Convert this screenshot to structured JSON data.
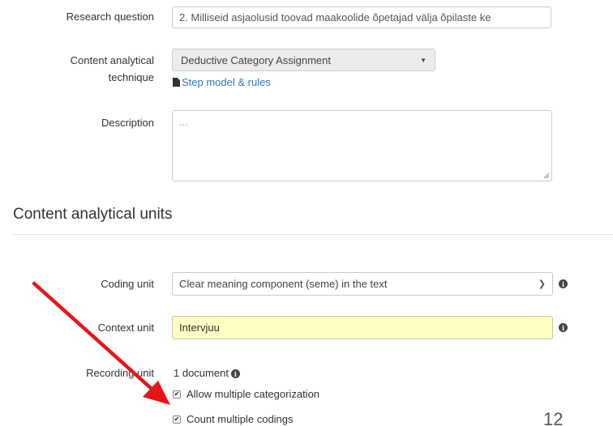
{
  "form": {
    "research_question": {
      "label": "Research question",
      "value": "2. Milliseid asjaolusid toovad maakoolide õpetajad välja õpilaste ke"
    },
    "technique": {
      "label_line1": "Content analytical",
      "label_line2": "technique",
      "value": "Deductive Category Assignment",
      "link": "Step model & rules"
    },
    "description": {
      "label": "Description",
      "placeholder": "..."
    }
  },
  "units": {
    "heading": "Content analytical units",
    "coding_unit": {
      "label": "Coding unit",
      "value": "Clear meaning component (seme) in the text"
    },
    "context_unit": {
      "label": "Context unit",
      "value": "Intervjuu"
    },
    "recording_unit": {
      "label": "Recording unit",
      "value": "1 document",
      "options": [
        {
          "label": "Allow multiple categorization",
          "checked": true
        },
        {
          "label": "Count multiple codings",
          "checked": true
        }
      ]
    }
  },
  "slide_number": "12",
  "colors": {
    "link": "#2a7ac2",
    "highlight_field": "#ffffc4",
    "annotation_arrow": "#e8141b"
  }
}
